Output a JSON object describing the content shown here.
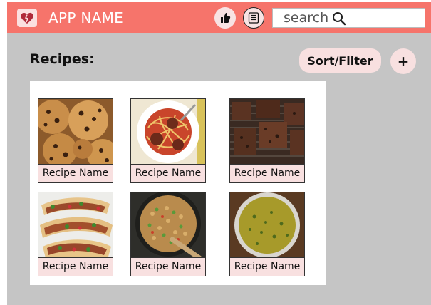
{
  "header": {
    "app_name": "APP NAME",
    "icons": {
      "logo": "heart-logo-icon",
      "like": "thumbs-up-icon",
      "list": "list-icon",
      "search": "search-icon"
    },
    "search": {
      "placeholder": "search"
    },
    "colors": {
      "bar": "#f6746b",
      "accent": "#f8e0e0",
      "background": "#c5c5c5"
    }
  },
  "main": {
    "title": "Recipes:",
    "sort_filter_label": "Sort/Filter",
    "add_label": "+"
  },
  "recipes": [
    {
      "name": "Recipe Name",
      "image": "chocolate-chip-cookies"
    },
    {
      "name": "Recipe Name",
      "image": "spaghetti-and-meatballs"
    },
    {
      "name": "Recipe Name",
      "image": "brownies"
    },
    {
      "name": "Recipe Name",
      "image": "tacos"
    },
    {
      "name": "Recipe Name",
      "image": "fried-rice-in-skillet"
    },
    {
      "name": "Recipe Name",
      "image": "green-soup"
    }
  ]
}
